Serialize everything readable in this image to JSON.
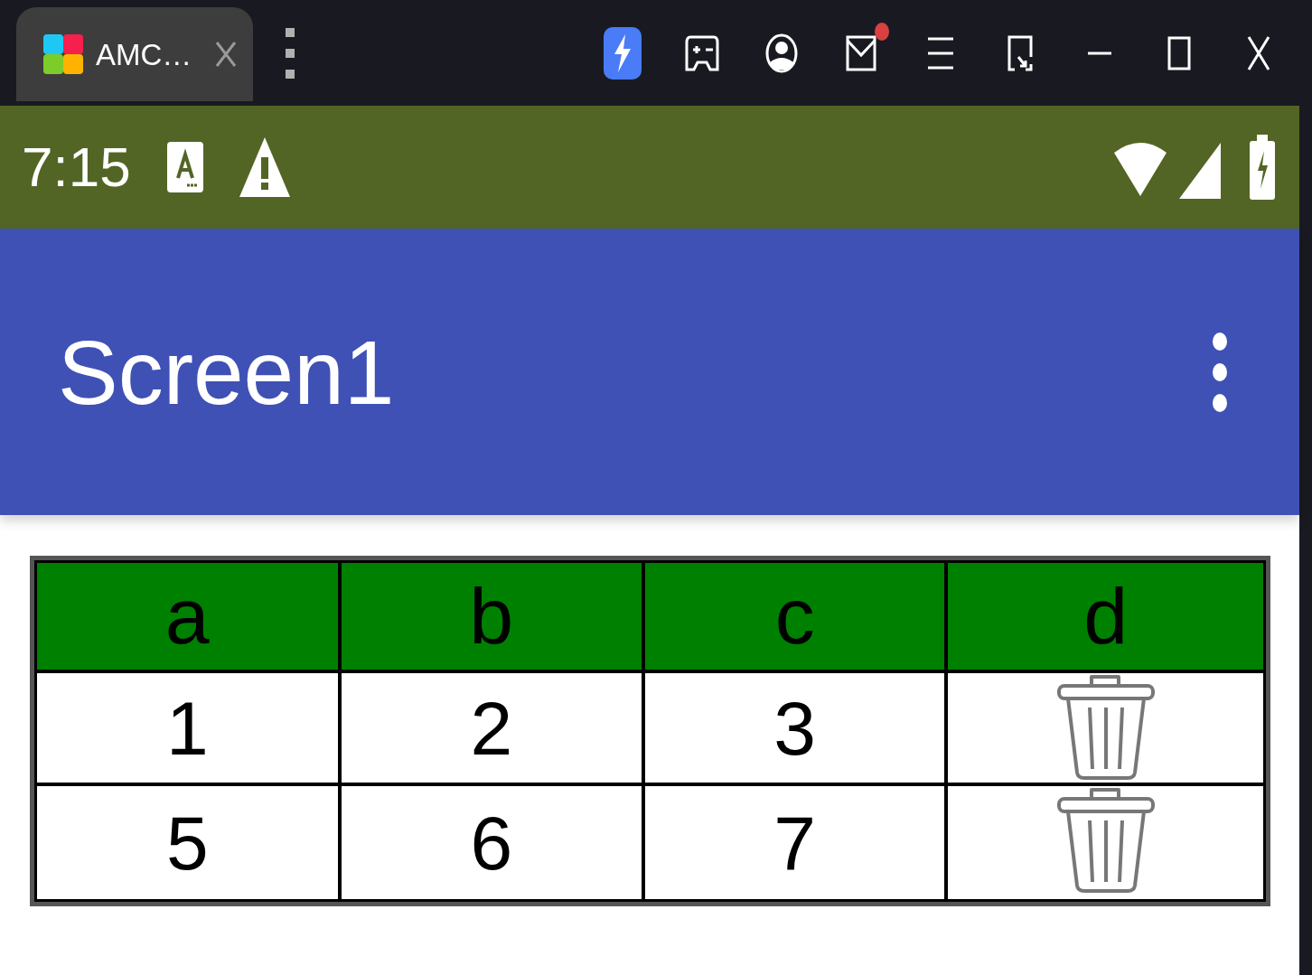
{
  "browser_tab": {
    "title": "AMC…"
  },
  "toolbar": {
    "mail_badge": true
  },
  "status_bar": {
    "time": "7:15"
  },
  "app_bar": {
    "title": "Screen1"
  },
  "table": {
    "columns": [
      "a",
      "b",
      "c",
      "d"
    ],
    "rows": [
      {
        "cells": [
          "1",
          "2",
          "3"
        ]
      },
      {
        "cells": [
          "5",
          "6",
          "7"
        ]
      }
    ]
  }
}
